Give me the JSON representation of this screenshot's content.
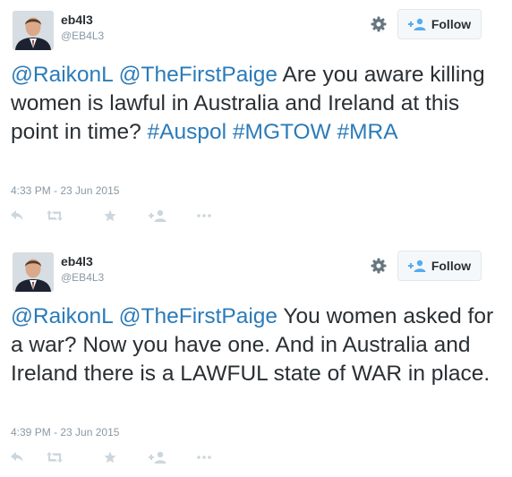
{
  "colors": {
    "link": "#2b7bb9",
    "text": "#292f33",
    "meta": "#8899a6",
    "icon": "#ccd6dd",
    "follow_icon": "#55acee"
  },
  "follow_label": "Follow",
  "icons": {
    "avatar": "user-avatar",
    "settings": "gear-icon",
    "follow": "add-user-icon",
    "reply": "reply-icon",
    "retweet": "retweet-icon",
    "favorite": "star-icon",
    "follow_action": "add-user-icon",
    "more": "more-icon"
  },
  "tweets": [
    {
      "name": "eb4l3",
      "handle": "@EB4L3",
      "mention1": "@RaikonL",
      "mention2": "@TheFirstPaige",
      "body": "Are you aware killing women is lawful in Australia and Ireland at this point in time?",
      "hashtag1": "#Auspol",
      "hashtag2": "#MGTOW",
      "hashtag3": "#MRA",
      "timestamp": "4:33 PM - 23 Jun 2015"
    },
    {
      "name": "eb4l3",
      "handle": "@EB4L3",
      "mention1": "@RaikonL",
      "mention2": "@TheFirstPaige",
      "body": "You women asked for a war? Now you have one. And in Australia and Ireland there is a LAWFUL state of WAR in place.",
      "timestamp": "4:39 PM - 23 Jun 2015"
    }
  ]
}
